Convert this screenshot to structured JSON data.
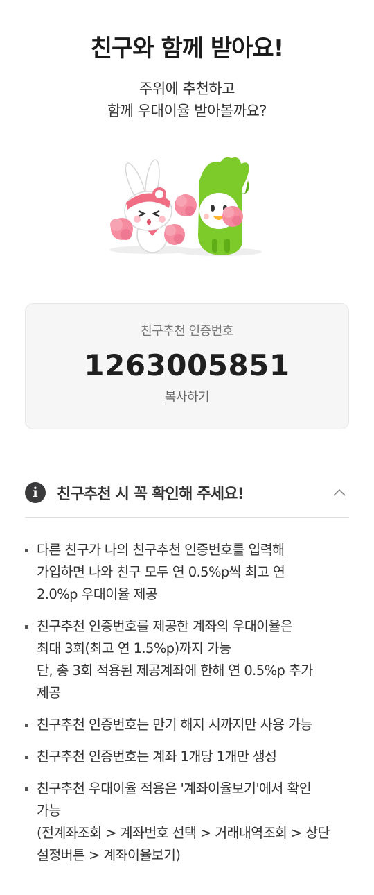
{
  "header": {
    "title": "친구와 함께 받아요!",
    "subtitle_line1": "주위에 추천하고",
    "subtitle_line2": "함께 우대이율 받아볼까요?"
  },
  "illustration": {
    "characters": [
      "bunny-cheerleader-icon",
      "green-dinosaur-cheerleader-icon"
    ]
  },
  "referral": {
    "label": "친구추천 인증번호",
    "code": "1263005851",
    "copy_label": "복사하기"
  },
  "notice": {
    "title": "친구추천 시 꼭 확인해 주세요!",
    "icon": "info-icon",
    "expand_icon": "chevron-up-icon",
    "items": [
      {
        "lines": [
          "다른 친구가 나의 친구추천 인증번호를 입력해",
          "가입하면 나와 친구 모두 연 0.5%p씩 최고 연",
          "2.0%p 우대이율 제공"
        ]
      },
      {
        "lines": [
          "친구추천 인증번호를 제공한 계좌의 우대이율은",
          "최대 3회(최고 연 1.5%p)까지 가능",
          "단, 총 3회 적용된 제공계좌에 한해 연 0.5%p 추가",
          "제공"
        ]
      },
      {
        "lines": [
          "친구추천 인증번호는 만기 해지 시까지만 사용 가능"
        ]
      },
      {
        "lines": [
          "친구추천 인증번호는 계좌 1개당 1개만 생성"
        ]
      },
      {
        "lines": [
          "친구추천 우대이율 적용은 '계좌이율보기'에서 확인",
          "가능",
          "(전계좌조회 > 계좌번호 선택 > 거래내역조회 > 상단",
          "설정버튼 > 계좌이율보기)"
        ]
      }
    ]
  },
  "colors": {
    "bunny_accent": "#f06d84",
    "pompom_pink": "#f58ca0",
    "dino_green": "#7ccb2b",
    "card_bg": "#f6f6f7"
  }
}
